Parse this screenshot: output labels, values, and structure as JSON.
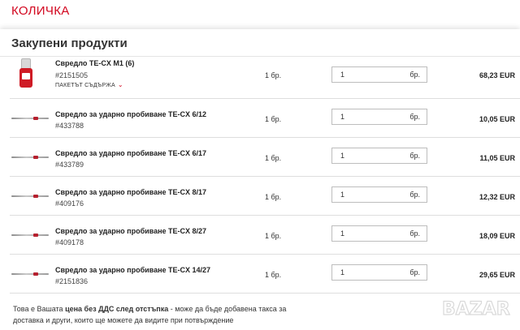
{
  "page": {
    "top_title": "КОЛИЧКА",
    "section_title": "Закупени продукти"
  },
  "products": [
    {
      "name": "Свредло TE-CX M1 (6)",
      "sku": "#2151505",
      "package_label": "ПАКЕТЪТ СЪДЪРЖА",
      "unit": "1 бр.",
      "quantity": "1",
      "quantity_unit": "бр.",
      "price": "68,23 EUR",
      "thumb": "drill-box-icon"
    },
    {
      "name": "Свредло за ударно пробиване TE-CX 6/12",
      "sku": "#433788",
      "unit": "1 бр.",
      "quantity": "1",
      "quantity_unit": "бр.",
      "price": "10,05 EUR",
      "thumb": "drill-bit-icon"
    },
    {
      "name": "Свредло за ударно пробиване TE-CX 6/17",
      "sku": "#433789",
      "unit": "1 бр.",
      "quantity": "1",
      "quantity_unit": "бр.",
      "price": "11,05 EUR",
      "thumb": "drill-bit-icon"
    },
    {
      "name": "Свредло за ударно пробиване TE-CX 8/17",
      "sku": "#409176",
      "unit": "1 бр.",
      "quantity": "1",
      "quantity_unit": "бр.",
      "price": "12,32 EUR",
      "thumb": "drill-bit-icon"
    },
    {
      "name": "Свредло за ударно пробиване TE-CX 8/27",
      "sku": "#409178",
      "unit": "1 бр.",
      "quantity": "1",
      "quantity_unit": "бр.",
      "price": "18,09 EUR",
      "thumb": "drill-bit-icon"
    },
    {
      "name": "Свредло за ударно пробиване TE-CX 14/27",
      "sku": "#2151836",
      "unit": "1 бр.",
      "quantity": "1",
      "quantity_unit": "бр.",
      "price": "29,65 EUR",
      "thumb": "drill-bit-icon"
    }
  ],
  "footer": {
    "text_before": "Това е Вашата ",
    "text_bold": "цена без ДДС след отстъпка",
    "text_after": " - може да бъде добавена такса за доставка и други, които ще можете да видите при потвърждение"
  },
  "watermark": {
    "text": "BAZAR"
  },
  "colors": {
    "accent": "#d2051e"
  }
}
